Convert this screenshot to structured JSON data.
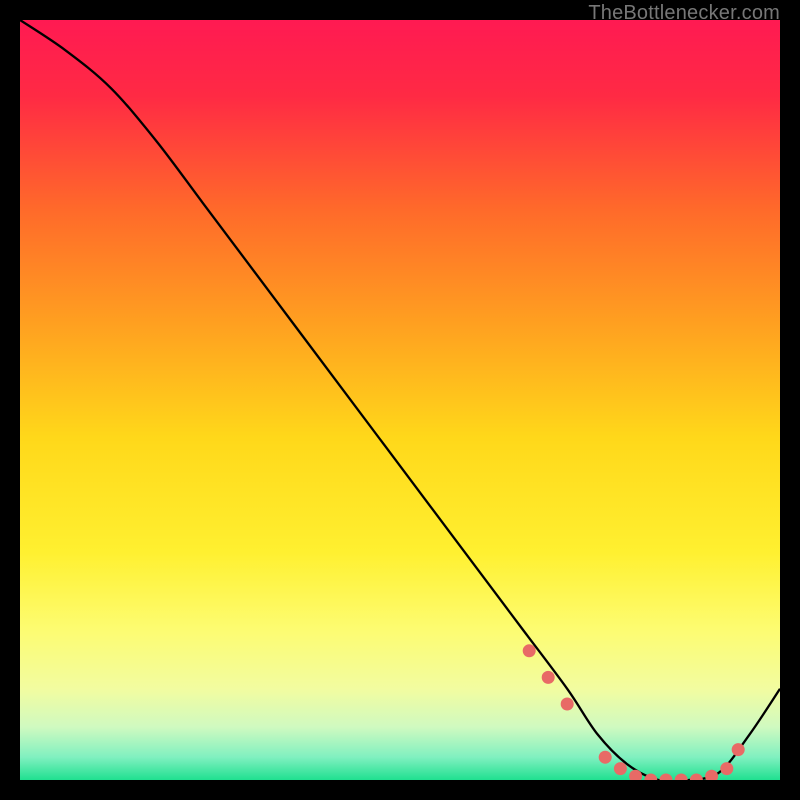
{
  "attribution": "TheBottlenecker.com",
  "chart_data": {
    "type": "line",
    "title": "",
    "xlabel": "",
    "ylabel": "",
    "xlim": [
      0,
      100
    ],
    "ylim": [
      0,
      100
    ],
    "series": [
      {
        "name": "curve",
        "x": [
          0,
          6,
          12,
          18,
          24,
          30,
          36,
          42,
          48,
          54,
          60,
          66,
          72,
          76,
          80,
          84,
          88,
          92,
          96,
          100
        ],
        "y": [
          100,
          96,
          91,
          84,
          76,
          68,
          60,
          52,
          44,
          36,
          28,
          20,
          12,
          6,
          2,
          0,
          0,
          1,
          6,
          12
        ]
      }
    ],
    "markers": {
      "name": "dots",
      "x": [
        67,
        69.5,
        72,
        77,
        79,
        81,
        83,
        85,
        87,
        89,
        91,
        93,
        94.5
      ],
      "y": [
        17,
        13.5,
        10,
        3,
        1.5,
        0.5,
        0,
        0,
        0,
        0,
        0.5,
        1.5,
        4
      ]
    },
    "gradient_stops": [
      {
        "offset": 0,
        "color": "#ff1a52"
      },
      {
        "offset": 0.1,
        "color": "#ff2a44"
      },
      {
        "offset": 0.25,
        "color": "#ff6a2a"
      },
      {
        "offset": 0.4,
        "color": "#ffa020"
      },
      {
        "offset": 0.55,
        "color": "#ffd81a"
      },
      {
        "offset": 0.7,
        "color": "#fff030"
      },
      {
        "offset": 0.8,
        "color": "#fdfc70"
      },
      {
        "offset": 0.88,
        "color": "#f2fca0"
      },
      {
        "offset": 0.93,
        "color": "#d0fac0"
      },
      {
        "offset": 0.97,
        "color": "#80f0c0"
      },
      {
        "offset": 1.0,
        "color": "#20e090"
      }
    ],
    "line_color": "#000000",
    "marker_color": "#e86a66"
  }
}
